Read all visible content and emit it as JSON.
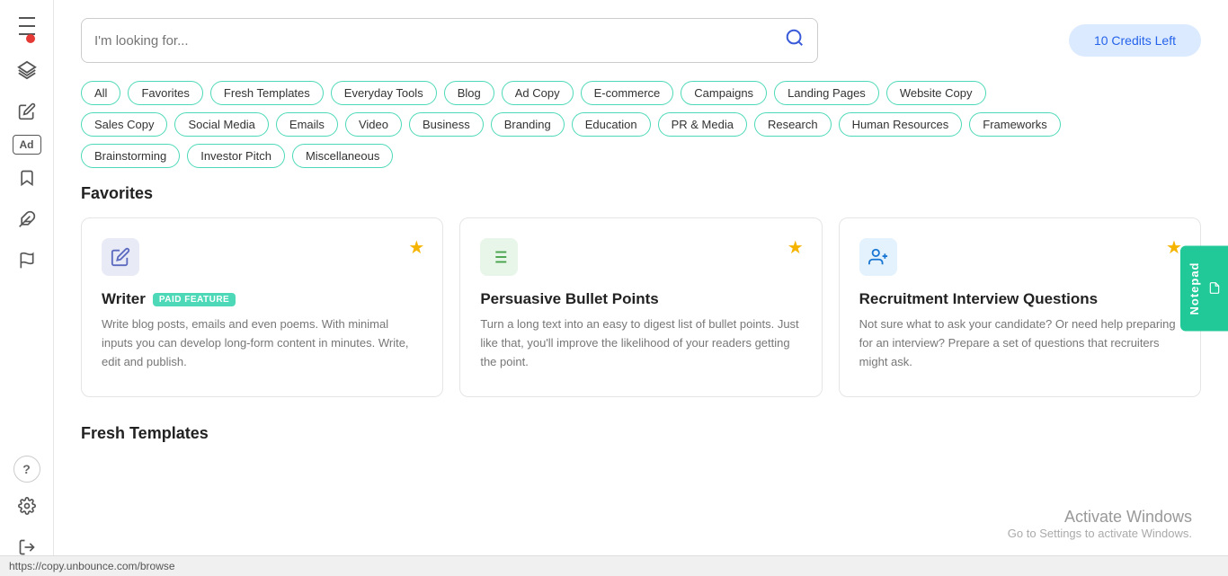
{
  "sidebar": {
    "items": [
      {
        "name": "menu-icon",
        "icon": "☰",
        "label": "Menu"
      },
      {
        "name": "layers-icon",
        "icon": "⊞",
        "label": "Layers"
      },
      {
        "name": "edit-icon",
        "icon": "✏",
        "label": "Edit"
      },
      {
        "name": "ad-icon",
        "icon": "Ad",
        "label": "Ad"
      },
      {
        "name": "bookmark-icon",
        "icon": "🔖",
        "label": "Bookmark"
      },
      {
        "name": "plugin-icon",
        "icon": "⬡",
        "label": "Plugin"
      },
      {
        "name": "flag-icon",
        "icon": "⚑",
        "label": "Flag"
      },
      {
        "name": "help-icon",
        "icon": "?",
        "label": "Help"
      },
      {
        "name": "settings-icon",
        "icon": "⚙",
        "label": "Settings"
      },
      {
        "name": "logout-icon",
        "icon": "→",
        "label": "Logout"
      }
    ]
  },
  "search": {
    "placeholder": "I'm looking for..."
  },
  "credits": {
    "label": "10 Credits Left"
  },
  "tags": {
    "row1": [
      {
        "id": "all",
        "label": "All"
      },
      {
        "id": "favorites",
        "label": "Favorites"
      },
      {
        "id": "fresh-templates",
        "label": "Fresh Templates"
      },
      {
        "id": "everyday-tools",
        "label": "Everyday Tools"
      },
      {
        "id": "blog",
        "label": "Blog"
      },
      {
        "id": "ad-copy",
        "label": "Ad Copy"
      },
      {
        "id": "ecommerce",
        "label": "E-commerce"
      },
      {
        "id": "campaigns",
        "label": "Campaigns"
      },
      {
        "id": "landing-pages",
        "label": "Landing Pages"
      },
      {
        "id": "website-copy",
        "label": "Website Copy"
      }
    ],
    "row2": [
      {
        "id": "sales-copy",
        "label": "Sales Copy"
      },
      {
        "id": "social-media",
        "label": "Social Media"
      },
      {
        "id": "emails",
        "label": "Emails"
      },
      {
        "id": "video",
        "label": "Video"
      },
      {
        "id": "business",
        "label": "Business"
      },
      {
        "id": "branding",
        "label": "Branding"
      },
      {
        "id": "education",
        "label": "Education"
      },
      {
        "id": "pr-media",
        "label": "PR & Media"
      },
      {
        "id": "research",
        "label": "Research"
      },
      {
        "id": "human-resources",
        "label": "Human Resources"
      },
      {
        "id": "frameworks",
        "label": "Frameworks"
      }
    ],
    "row3": [
      {
        "id": "brainstorming",
        "label": "Brainstorming"
      },
      {
        "id": "investor-pitch",
        "label": "Investor Pitch"
      },
      {
        "id": "miscellaneous",
        "label": "Miscellaneous"
      }
    ]
  },
  "favorites": {
    "section_title": "Favorites",
    "cards": [
      {
        "id": "writer",
        "title": "Writer",
        "paid": true,
        "paid_label": "PAID FEATURE",
        "description": "Write blog posts, emails and even poems. With minimal inputs you can develop long-form content in minutes. Write, edit and publish.",
        "starred": true
      },
      {
        "id": "persuasive-bullet-points",
        "title": "Persuasive Bullet Points",
        "paid": false,
        "description": "Turn a long text into an easy to digest list of bullet points. Just like that, you'll improve the likelihood of your readers getting the point.",
        "starred": true
      },
      {
        "id": "recruitment-interview-questions",
        "title": "Recruitment Interview Questions",
        "paid": false,
        "description": "Not sure what to ask your candidate? Or need help preparing for an interview? Prepare a set of questions that recruiters might ask.",
        "starred": true
      }
    ]
  },
  "fresh_templates": {
    "section_title": "Fresh Templates"
  },
  "notepad": {
    "label": "Notepad"
  },
  "status_bar": {
    "url": "https://copy.unbounce.com/browse"
  },
  "activation": {
    "title": "Activate Windows",
    "subtitle": "Go to Settings to activate Windows."
  }
}
